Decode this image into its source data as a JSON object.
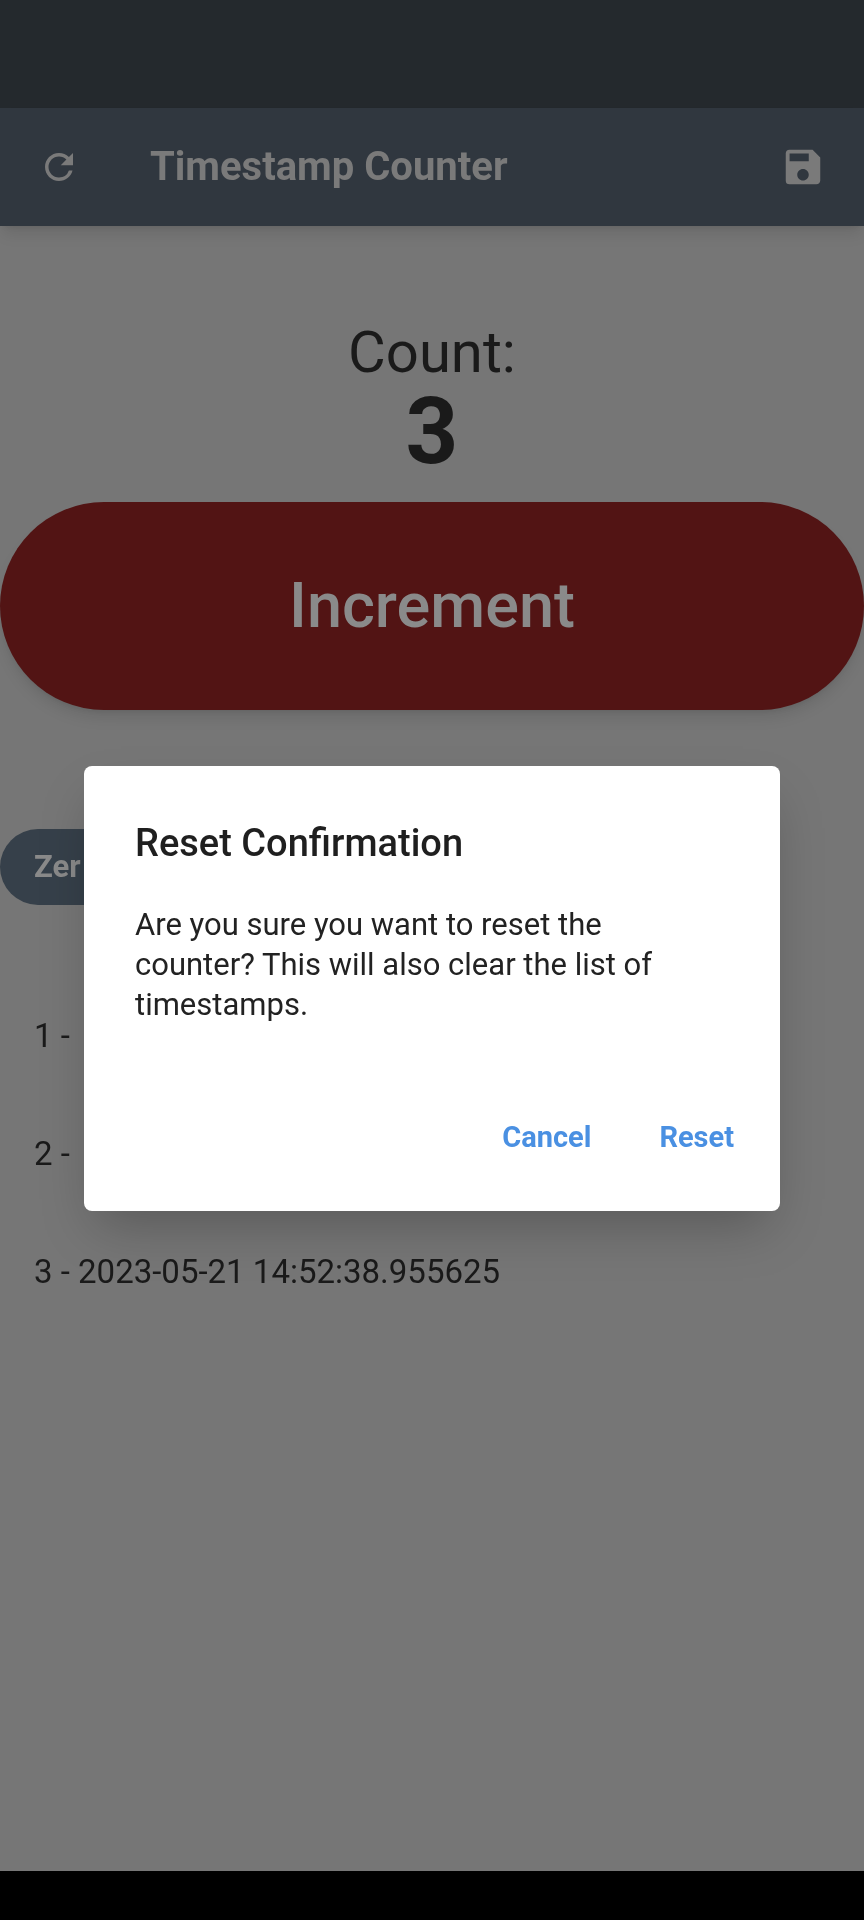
{
  "app_bar": {
    "title": "Timestamp Counter"
  },
  "counter": {
    "label": "Count:",
    "value": "3"
  },
  "increment_button": {
    "label": "Increment"
  },
  "chip": {
    "label": "Zer"
  },
  "timestamps": [
    "1 -",
    "2 -",
    "3 - 2023-05-21 14:52:38.955625"
  ],
  "dialog": {
    "title": "Reset Confirmation",
    "message": "Are you sure you want to reset the counter? This will also clear the list of timestamps.",
    "actions": [
      "Cancel",
      "Reset"
    ]
  }
}
